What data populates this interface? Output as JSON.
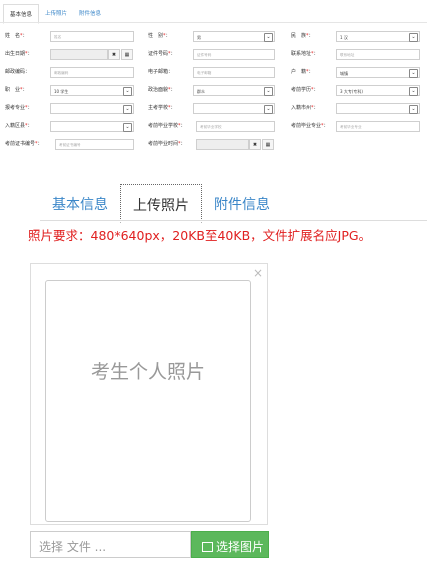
{
  "top": {
    "tabs": [
      "基本信息",
      "上传照片",
      "附件信息"
    ],
    "rows": [
      [
        {
          "label": "姓　名",
          "req": true,
          "type": "input",
          "placeholder": "姓名"
        },
        {
          "label": "性　别",
          "req": true,
          "type": "select",
          "value": "男"
        },
        {
          "label": "民　族",
          "req": true,
          "type": "select",
          "value": "1 汉"
        }
      ],
      [
        {
          "label": "出生日期",
          "req": true,
          "type": "date"
        },
        {
          "label": "证件号码",
          "req": true,
          "type": "input",
          "placeholder": "证件号码"
        },
        {
          "label": "联系地址",
          "req": true,
          "type": "input",
          "placeholder": "联系地址"
        }
      ],
      [
        {
          "label": "邮政编码",
          "req": false,
          "type": "input",
          "placeholder": "邮政编码"
        },
        {
          "label": "电子邮箱",
          "req": false,
          "type": "input",
          "placeholder": "电子邮箱"
        },
        {
          "label": "户　籍",
          "req": true,
          "type": "select",
          "value": "城镇"
        }
      ],
      [
        {
          "label": "职　业",
          "req": true,
          "type": "select",
          "value": "10 学生"
        },
        {
          "label": "政治面貌",
          "req": true,
          "type": "select",
          "value": "群众"
        },
        {
          "label": "考前学历",
          "req": true,
          "type": "select",
          "value": "3 大专(专科)"
        }
      ],
      [
        {
          "label": "报考专业",
          "req": true,
          "type": "select",
          "value": ""
        },
        {
          "label": "主考学校",
          "req": true,
          "type": "select",
          "value": ""
        },
        {
          "label": "入籍市州",
          "req": true,
          "type": "select",
          "value": ""
        }
      ],
      [
        {
          "label": "入籍区县",
          "req": true,
          "type": "select",
          "value": ""
        },
        {
          "label": "考前毕业学校",
          "req": true,
          "type": "input",
          "placeholder": "考前毕业学校"
        },
        {
          "label": "考前毕业专业",
          "req": true,
          "type": "input",
          "placeholder": "考前毕业专业"
        }
      ],
      [
        {
          "label": "考前证书编号",
          "req": true,
          "type": "input",
          "placeholder": "考前证书编号"
        },
        {
          "label": "考前毕业时间",
          "req": true,
          "type": "date"
        }
      ]
    ],
    "clear_glyph": "✖",
    "calendar_glyph": "▦",
    "dropdown_glyph": "⌄",
    "colon": "："
  },
  "bottom": {
    "tabs": [
      "基本信息",
      "上传照片",
      "附件信息"
    ],
    "requirement": "照片要求：480*640px，20KB至40KB，文件扩展名应JPG。",
    "close_glyph": "×",
    "photo_placeholder": "考生个人照片",
    "file_placeholder": "选择 文件 ...",
    "choose_button": "选择图片"
  }
}
